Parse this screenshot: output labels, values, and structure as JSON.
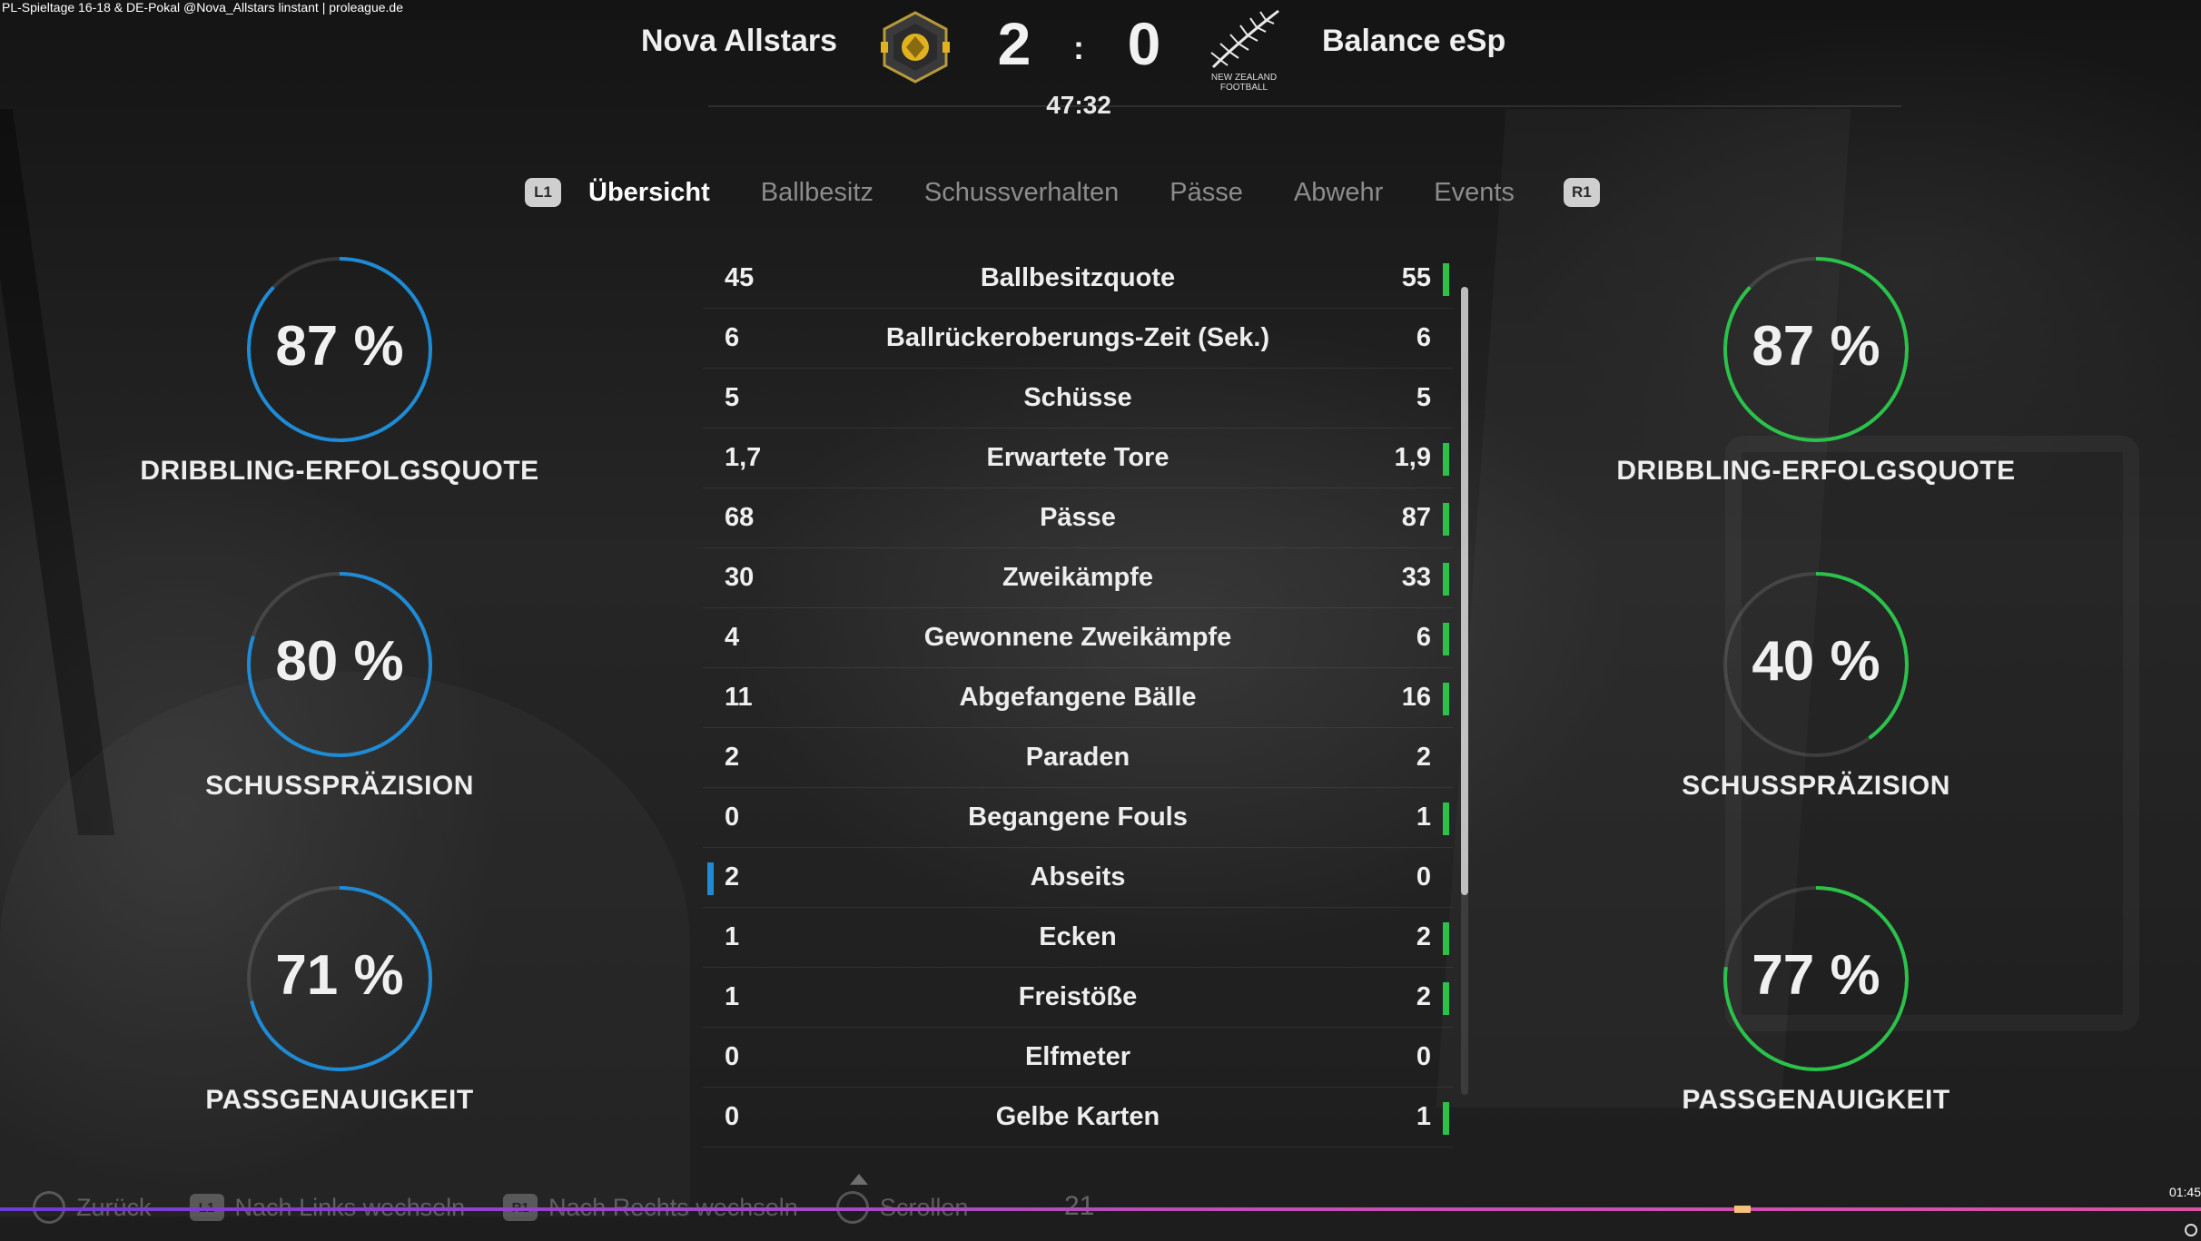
{
  "stream_title": "PL-Spieltage 16-18 & DE-Pokal @Nova_Allstars linstant | proleague.de",
  "header": {
    "home_team": "Nova Allstars",
    "away_team": "Balance eSp",
    "home_score": "2",
    "score_separator": ":",
    "away_score": "0",
    "match_clock": "47:32",
    "away_crest_text_line1": "NEW ZEALAND",
    "away_crest_text_line2": "FOOTBALL"
  },
  "colors": {
    "home_accent": "#1e8bd6",
    "away_accent": "#2bc24a"
  },
  "tabs": {
    "left_bumper": "L1",
    "right_bumper": "R1",
    "items": [
      {
        "label": "Übersicht",
        "active": true
      },
      {
        "label": "Ballbesitz",
        "active": false
      },
      {
        "label": "Schussverhalten",
        "active": false
      },
      {
        "label": "Pässe",
        "active": false
      },
      {
        "label": "Abwehr",
        "active": false
      },
      {
        "label": "Events",
        "active": false
      }
    ]
  },
  "home_rings": [
    {
      "value": "87 %",
      "percent": 87,
      "label": "DRIBBLING-ERFOLGSQUOTE"
    },
    {
      "value": "80 %",
      "percent": 80,
      "label": "SCHUSSPRÄZISION"
    },
    {
      "value": "71 %",
      "percent": 71,
      "label": "PASSGENAUIGKEIT"
    }
  ],
  "away_rings": [
    {
      "value": "87 %",
      "percent": 87,
      "label": "DRIBBLING-ERFOLGSQUOTE"
    },
    {
      "value": "40 %",
      "percent": 40,
      "label": "SCHUSSPRÄZISION"
    },
    {
      "value": "77 %",
      "percent": 77,
      "label": "PASSGENAUIGKEIT"
    }
  ],
  "stats": [
    {
      "label": "Ballbesitzquote",
      "home": "45",
      "away": "55",
      "leader": "away"
    },
    {
      "label": "Ballrückeroberungs-Zeit (Sek.)",
      "home": "6",
      "away": "6",
      "leader": "none"
    },
    {
      "label": "Schüsse",
      "home": "5",
      "away": "5",
      "leader": "none"
    },
    {
      "label": "Erwartete Tore",
      "home": "1,7",
      "away": "1,9",
      "leader": "away"
    },
    {
      "label": "Pässe",
      "home": "68",
      "away": "87",
      "leader": "away"
    },
    {
      "label": "Zweikämpfe",
      "home": "30",
      "away": "33",
      "leader": "away"
    },
    {
      "label": "Gewonnene Zweikämpfe",
      "home": "4",
      "away": "6",
      "leader": "away"
    },
    {
      "label": "Abgefangene Bälle",
      "home": "11",
      "away": "16",
      "leader": "away"
    },
    {
      "label": "Paraden",
      "home": "2",
      "away": "2",
      "leader": "none"
    },
    {
      "label": "Begangene Fouls",
      "home": "0",
      "away": "1",
      "leader": "away"
    },
    {
      "label": "Abseits",
      "home": "2",
      "away": "0",
      "leader": "home"
    },
    {
      "label": "Ecken",
      "home": "1",
      "away": "2",
      "leader": "away"
    },
    {
      "label": "Freistöße",
      "home": "1",
      "away": "2",
      "leader": "away"
    },
    {
      "label": "Elfmeter",
      "home": "0",
      "away": "0",
      "leader": "none"
    },
    {
      "label": "Gelbe Karten",
      "home": "0",
      "away": "1",
      "leader": "away"
    }
  ],
  "footer": {
    "back_label": "Zurück",
    "left_bumper": "L1",
    "left_label": "Nach Links wechseln",
    "right_bumper": "R1",
    "right_label": "Nach Rechts wechseln",
    "scroll_label": "Scrollen",
    "count": "21"
  },
  "video": {
    "time": "01:45"
  }
}
